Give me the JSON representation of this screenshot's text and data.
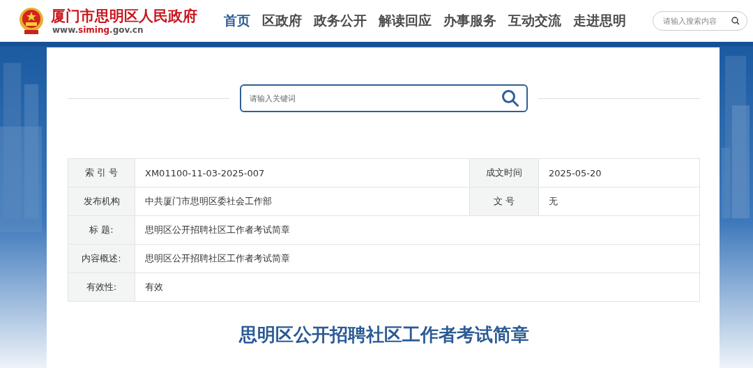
{
  "header": {
    "site_name": "厦门市思明区人民政府",
    "site_url": [
      {
        "text": "www.",
        "highlight": false
      },
      {
        "text": "siming",
        "highlight": true
      },
      {
        "text": ".gov.cn",
        "highlight": false
      }
    ],
    "nav": [
      {
        "label": "首页",
        "selected": true
      },
      {
        "label": "区政府",
        "selected": false
      },
      {
        "label": "政务公开",
        "selected": false
      },
      {
        "label": "解读回应",
        "selected": false
      },
      {
        "label": "办事服务",
        "selected": false
      },
      {
        "label": "互动交流",
        "selected": false
      },
      {
        "label": "走进思明",
        "selected": false
      }
    ],
    "search": {
      "placeholder": "请输入搜索内容"
    }
  },
  "keyword_search": {
    "placeholder": "请输入关键词"
  },
  "info_table": {
    "rows": [
      {
        "cells": [
          {
            "label": "索 引 号",
            "value": "XM01100-11-03-2025-007"
          },
          {
            "label": "成文时间",
            "value": "2025-05-20"
          }
        ]
      },
      {
        "cells": [
          {
            "label": "发布机构",
            "value": "中共厦门市思明区委社会工作部"
          },
          {
            "label": "文 号",
            "value": "无"
          }
        ]
      },
      {
        "cells": [
          {
            "label": "标 题:",
            "value": "思明区公开招聘社区工作者考试简章"
          }
        ]
      },
      {
        "cells": [
          {
            "label": "内容概述:",
            "value": "思明区公开招聘社区工作者考试简章"
          }
        ]
      },
      {
        "cells": [
          {
            "label": "有效性:",
            "value": "有效"
          }
        ]
      }
    ]
  },
  "article_title": "思明区公开招聘社区工作者考试简章"
}
